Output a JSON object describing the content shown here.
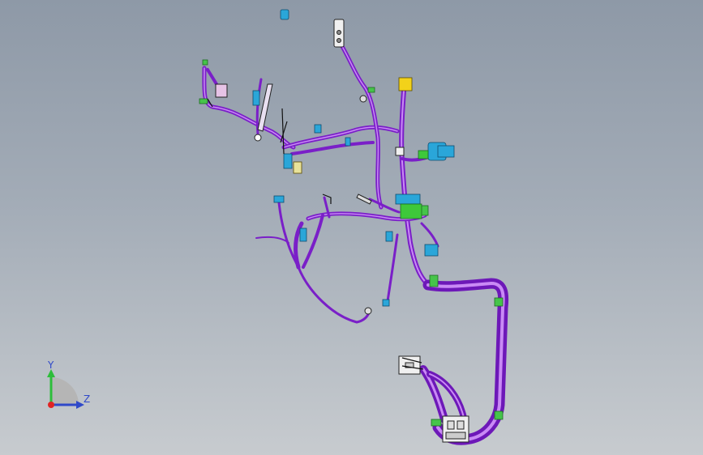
{
  "viewport": {
    "background_top": "#8e99a7",
    "background_bottom": "#c7cbcf"
  },
  "model": {
    "wire_color": "#8b2ad6",
    "wire_highlight": "#c98af5",
    "clip_color": "#46c44a",
    "connector_blue": "#2aa6d9",
    "connector_yellow": "#f2d21a",
    "connector_white": "#f0f0f0"
  },
  "triad": {
    "y_label": "Y",
    "z_label": "Z",
    "y_color": "#2dbd3a",
    "z_color": "#2f49c9",
    "origin_color": "#e02424",
    "icon": "reference-triad-icon"
  }
}
